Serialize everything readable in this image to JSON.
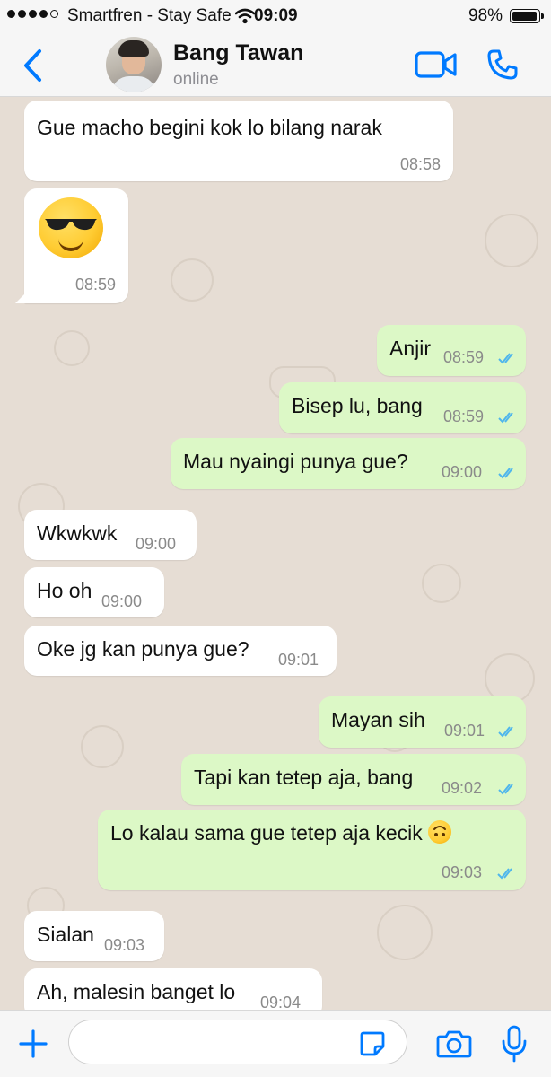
{
  "status_bar": {
    "carrier": "Smartfren - Stay Safe",
    "time": "09:09",
    "battery_percent": "98%",
    "battery_level": 0.98,
    "signal_bars": 4
  },
  "header": {
    "contact_name": "Bang Tawan",
    "contact_status": "online"
  },
  "colors": {
    "accent": "#007aff",
    "outgoing_bubble": "#dcf8c6",
    "incoming_bubble": "#ffffff",
    "read_ticks": "#4fb6ec",
    "chat_background": "#e6ddd4"
  },
  "messages": [
    {
      "dir": "in",
      "text": "Gue macho begini kok lo bilang narak",
      "time": "08:58"
    },
    {
      "dir": "in",
      "emoji": "smiling-face-with-sunglasses",
      "time": "08:59"
    },
    {
      "dir": "out",
      "text": "Anjir",
      "time": "08:59",
      "status": "read"
    },
    {
      "dir": "out",
      "text": "Bisep lu, bang",
      "time": "08:59",
      "status": "read"
    },
    {
      "dir": "out",
      "text": "Mau nyaingi punya gue?",
      "time": "09:00",
      "status": "read"
    },
    {
      "dir": "in",
      "text": "Wkwkwk",
      "time": "09:00"
    },
    {
      "dir": "in",
      "text": "Ho oh",
      "time": "09:00"
    },
    {
      "dir": "in",
      "text": "Oke jg kan punya gue?",
      "time": "09:01"
    },
    {
      "dir": "out",
      "text": "Mayan sih",
      "time": "09:01",
      "status": "read"
    },
    {
      "dir": "out",
      "text": "Tapi kan tetep aja, bang",
      "time": "09:02",
      "status": "read"
    },
    {
      "dir": "out",
      "text": "Lo kalau sama gue tetep aja kecik",
      "emoji": "upside-down-face",
      "time": "09:03",
      "status": "read"
    },
    {
      "dir": "in",
      "text": "Sialan",
      "time": "09:03"
    },
    {
      "dir": "in",
      "text": "Ah, malesin banget lo",
      "time": "09:04"
    }
  ],
  "input": {
    "value": "",
    "placeholder": ""
  },
  "icons": {
    "back": "chevron-left-icon",
    "video": "video-camera-icon",
    "call": "phone-icon",
    "attach": "plus-icon",
    "sticker": "sticker-icon",
    "camera": "camera-icon",
    "mic": "microphone-icon"
  }
}
